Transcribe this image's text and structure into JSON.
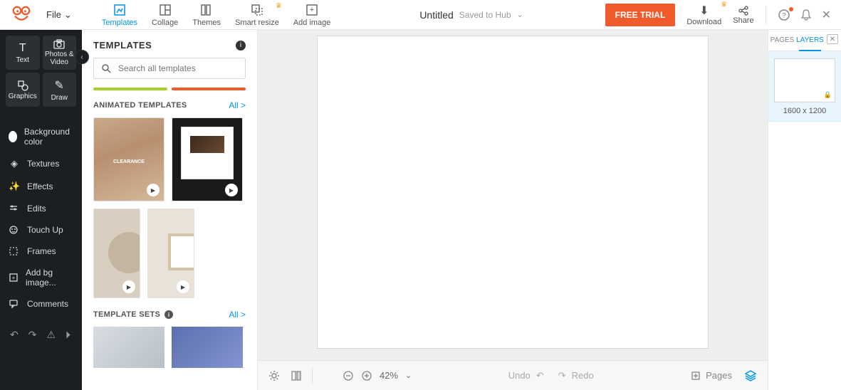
{
  "file_menu": "File",
  "top_tools": {
    "templates": "Templates",
    "collage": "Collage",
    "themes": "Themes",
    "smart_resize": "Smart resize",
    "add_image": "Add image"
  },
  "document": {
    "title": "Untitled",
    "saved_label": "Saved to Hub"
  },
  "cta": "FREE TRIAL",
  "right_tools": {
    "download": "Download",
    "share": "Share"
  },
  "left_rail": {
    "text": "Text",
    "photos_video": "Photos & Video",
    "graphics": "Graphics",
    "draw": "Draw",
    "background_color": "Background color",
    "textures": "Textures",
    "effects": "Effects",
    "edits": "Edits",
    "touch_up": "Touch Up",
    "frames": "Frames",
    "add_bg_image": "Add bg image...",
    "comments": "Comments"
  },
  "templates_panel": {
    "title": "TEMPLATES",
    "search_placeholder": "Search all templates",
    "animated_title": "ANIMATED TEMPLATES",
    "all": "All >",
    "sets_title": "TEMPLATE SETS"
  },
  "bottom": {
    "zoom": "42%",
    "undo": "Undo",
    "redo": "Redo",
    "pages": "Pages"
  },
  "right_panel": {
    "pages_tab": "PAGES",
    "layers_tab": "LAYERS",
    "dimensions": "1600 x 1200"
  }
}
